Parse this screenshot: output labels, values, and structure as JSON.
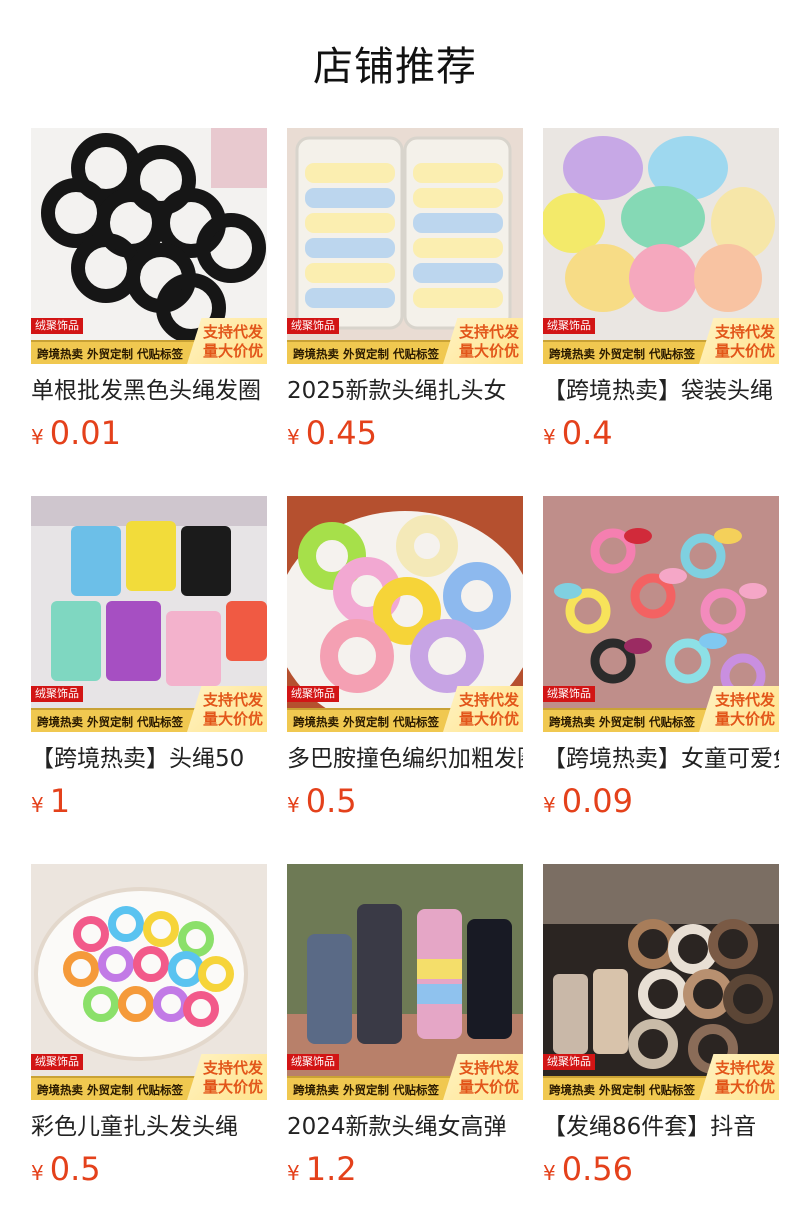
{
  "header": {
    "title": "店铺推荐"
  },
  "badge": {
    "store": "绒聚饰品",
    "strip": "跨境热卖 外贸定制 代贴标签",
    "corner_line1": "支持代发",
    "corner_line2": "量大价优"
  },
  "currency": "¥",
  "products": [
    {
      "name": "单根批发黑色头绳发圈",
      "price": "0.01",
      "image": "black-hair-ties"
    },
    {
      "name": "2025新款头绳扎头女",
      "price": "0.45",
      "image": "pastel-hair-ties-box"
    },
    {
      "name": "【跨境热卖】袋装头绳",
      "price": "0.4",
      "image": "bagged-colorful-hair-ties"
    },
    {
      "name": "【跨境热卖】头绳50",
      "price": "1",
      "image": "jarred-hair-ties"
    },
    {
      "name": "多巴胺撞色编织加粗发圈",
      "price": "0.5",
      "image": "braided-scrunchies"
    },
    {
      "name": "【跨境热卖】女童可爱兔耳",
      "price": "0.09",
      "image": "bunny-ear-hair-ties"
    },
    {
      "name": "彩色儿童扎头发头绳",
      "price": "0.5",
      "image": "rainbow-kids-hair-ties"
    },
    {
      "name": "2024新款头绳女高弹",
      "price": "1.2",
      "image": "tube-hair-ties"
    },
    {
      "name": "【发绳86件套】抖音",
      "price": "0.56",
      "image": "hair-tie-gift-set"
    }
  ],
  "colors": {
    "accent_price": "#e4411b",
    "badge_red": "#d21515",
    "strip_gold": "#f0c850"
  }
}
